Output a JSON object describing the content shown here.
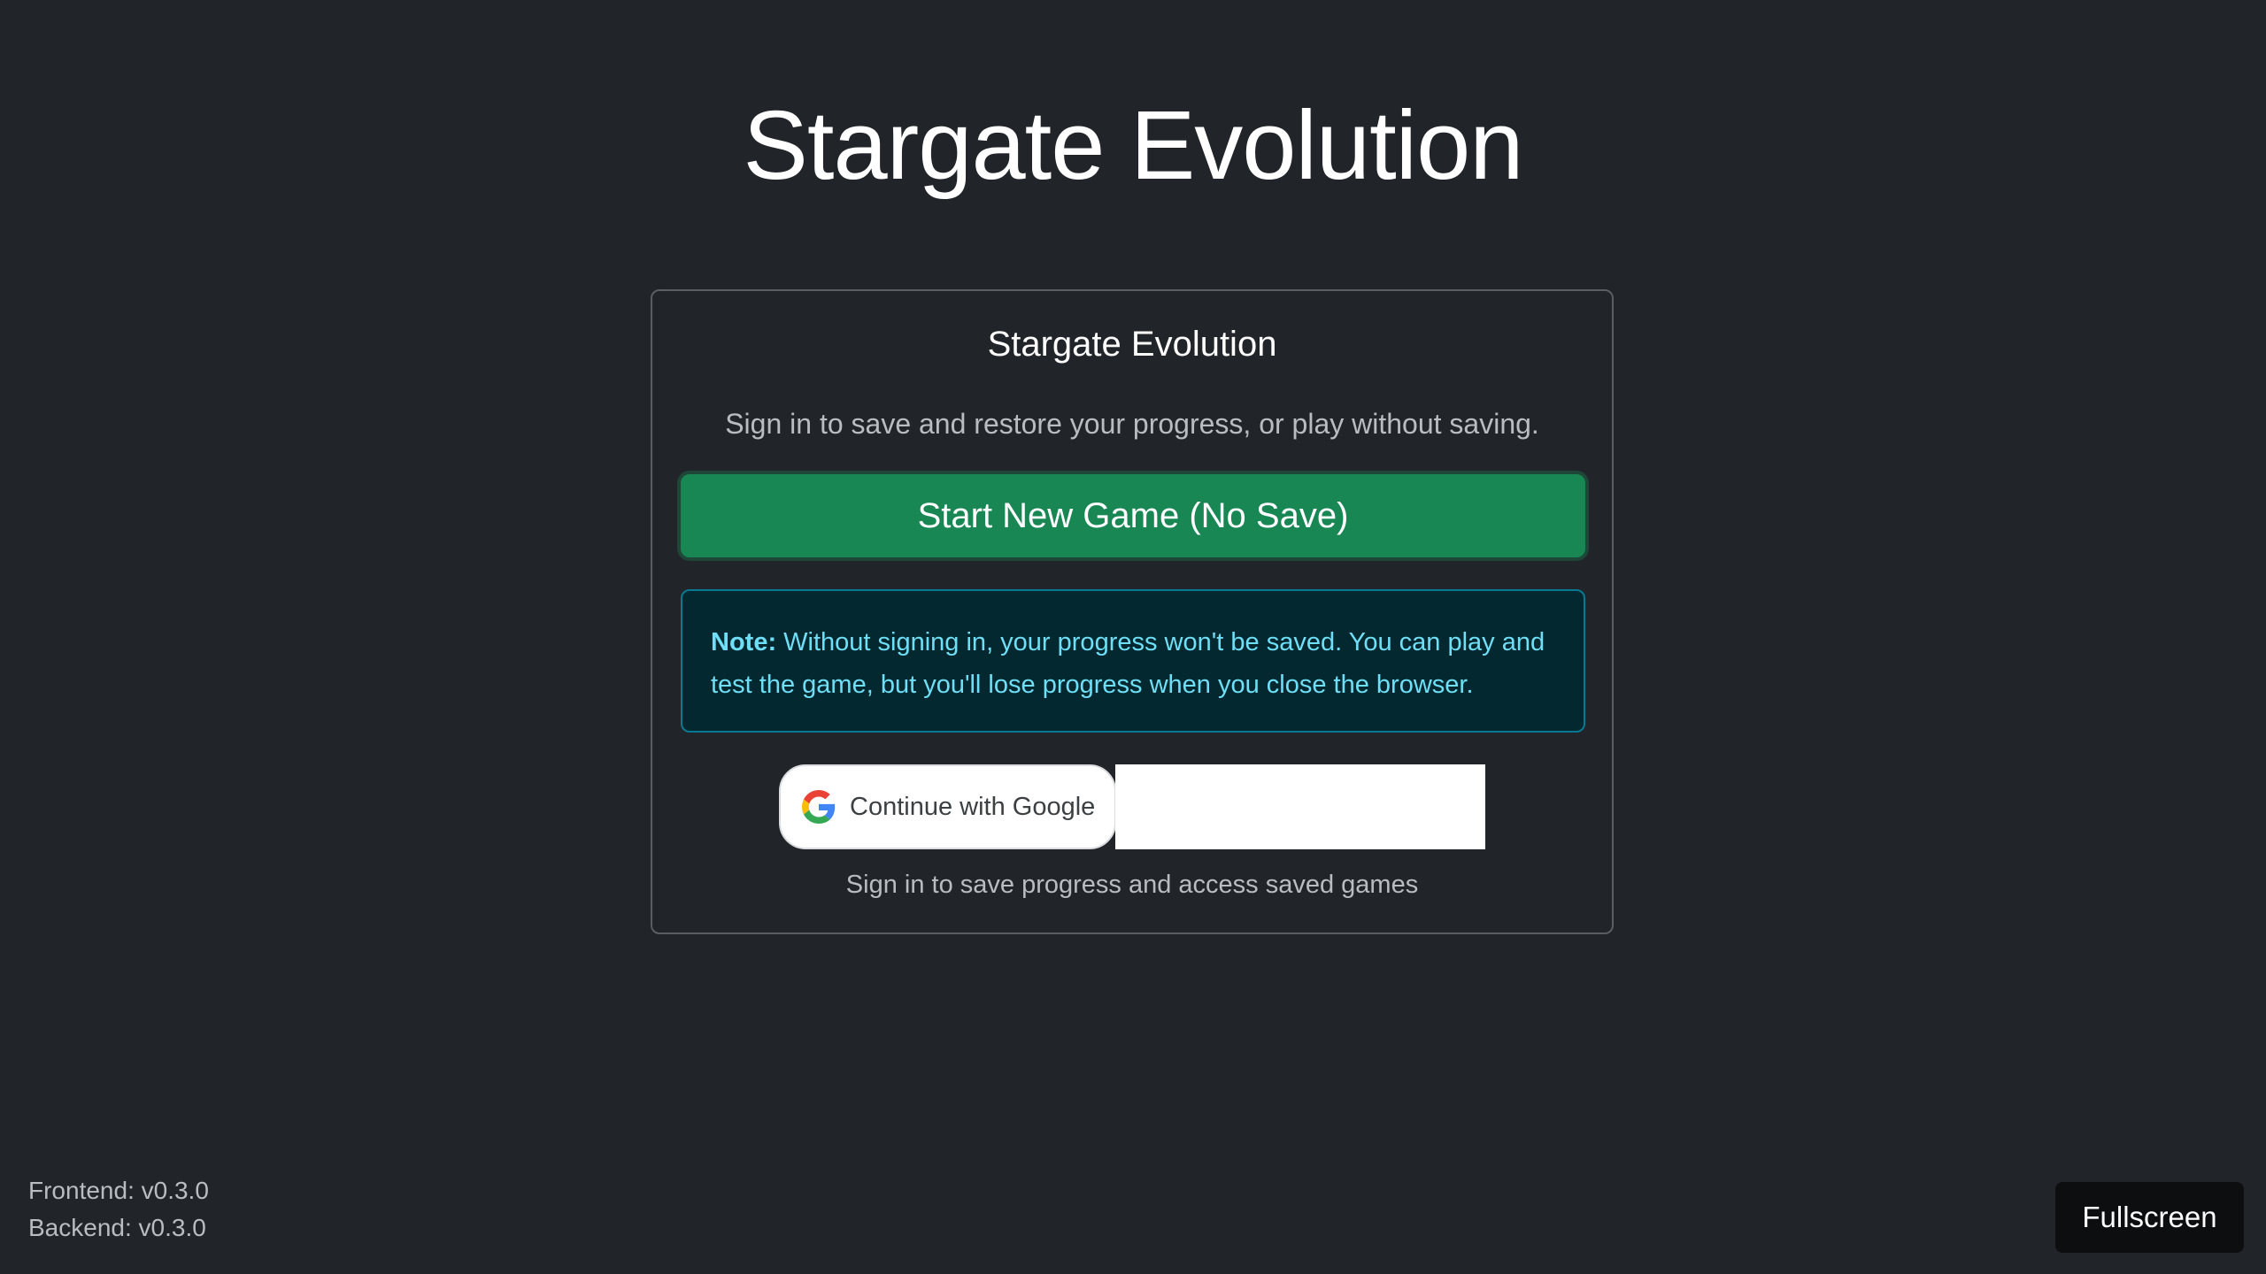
{
  "page": {
    "title": "Stargate Evolution"
  },
  "card": {
    "title": "Stargate Evolution",
    "subtitle": "Sign in to save and restore your progress, or play without saving.",
    "start_button_label": "Start New Game (No Save)",
    "note": {
      "label": "Note:",
      "text": " Without signing in, your progress won't be saved. You can play and test the game, but you'll lose progress when you close the browser."
    },
    "google_button_label": "Continue with Google",
    "signin_hint": "Sign in to save progress and access saved games"
  },
  "footer": {
    "frontend_version": "Frontend: v0.3.0",
    "backend_version": "Backend: v0.3.0",
    "fullscreen_label": "Fullscreen"
  },
  "colors": {
    "background": "#212529",
    "success": "#198754",
    "info_text": "#6edff6",
    "info_bg": "#032830",
    "info_border": "#087990"
  },
  "icons": {
    "google": "google-g-icon"
  }
}
